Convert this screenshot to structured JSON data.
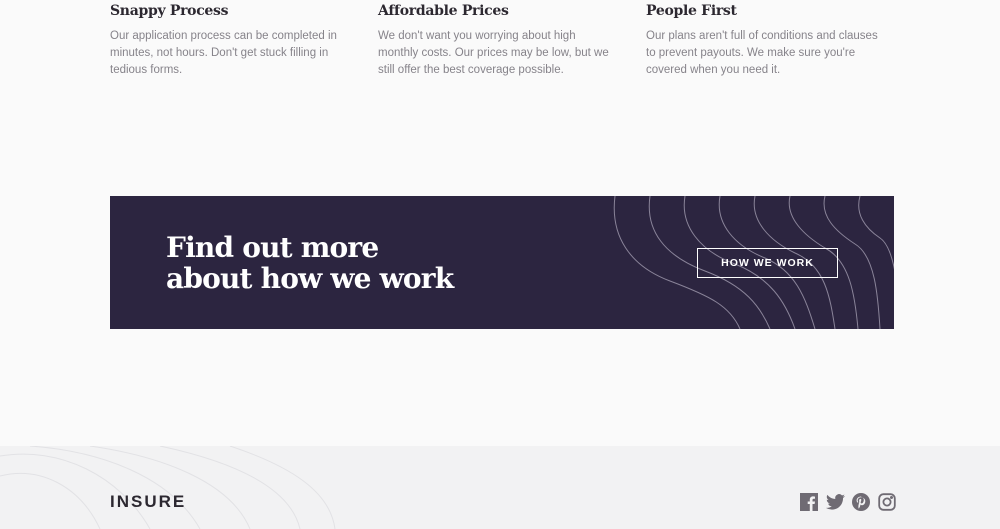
{
  "features": [
    {
      "title": "Snappy Process",
      "text": "Our application process can be completed in minutes, not hours. Don't get stuck filling in tedious forms."
    },
    {
      "title": "Affordable Prices",
      "text": "We don't want you worrying about high monthly costs. Our prices may be low, but we still offer the best coverage possible."
    },
    {
      "title": "People First",
      "text": "Our plans aren't full of conditions and clauses to prevent payouts. We make sure you're covered when you need it."
    }
  ],
  "banner": {
    "title_line1": "Find out more",
    "title_line2": "about how we work",
    "button_label": "HOW WE WORK"
  },
  "footer": {
    "logo": "INSURE",
    "social_icons": [
      "facebook-icon",
      "twitter-icon",
      "pinterest-icon",
      "instagram-icon"
    ]
  },
  "colors": {
    "banner_bg": "#2c2540",
    "page_bg": "#fafafa",
    "footer_bg": "#f2f2f3",
    "heading": "#2c2830",
    "body_text": "#86838a",
    "icon": "#6f6b73"
  }
}
